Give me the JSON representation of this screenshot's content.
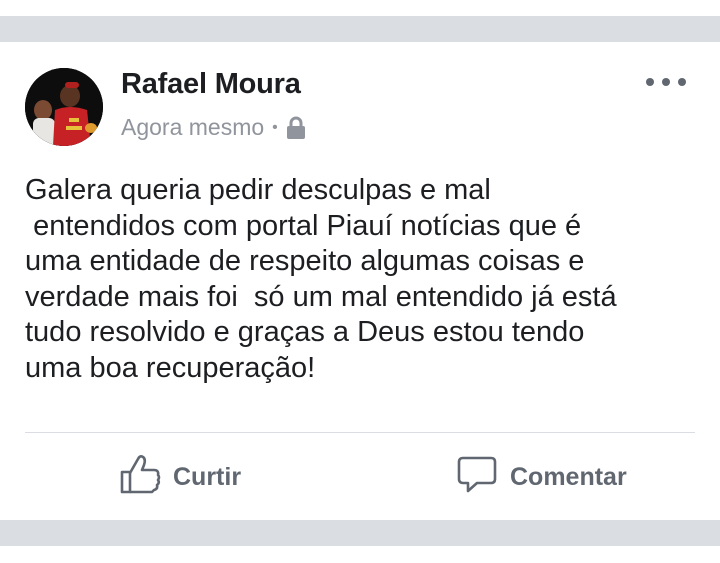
{
  "post": {
    "author": "Rafael Moura",
    "timestamp": "Agora mesmo",
    "separator": "•",
    "privacy_icon": "lock-icon",
    "more_icon": "more-options-icon",
    "text": "Galera queria pedir desculpas e mal\n entendidos com portal Piauí notícias que é\numa entidade de respeito algumas coisas e\nverdade mais foi  só um mal entendido já está\ntudo resolvido e graças a Deus estou tendo\numa boa recuperação!"
  },
  "actions": {
    "like": {
      "label": "Curtir",
      "icon": "thumbs-up-icon"
    },
    "comment": {
      "label": "Comentar",
      "icon": "comment-bubble-icon"
    }
  },
  "colors": {
    "separator_band": "#dadde1",
    "text_primary": "#1c1e21",
    "text_secondary": "#90949c",
    "action_gray": "#606770"
  }
}
